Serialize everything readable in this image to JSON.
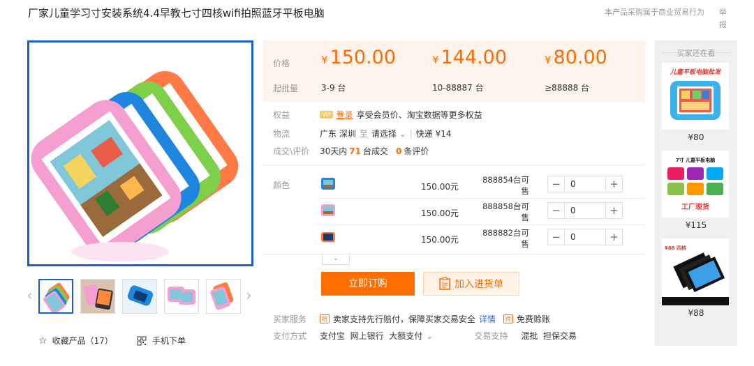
{
  "product": {
    "title": "厂家儿童学习寸安装系统4.4早教七寸四核wifi拍照蓝牙平板电脑",
    "report_note": "本产品采购属于商业贸易行为",
    "report_link": "举报"
  },
  "pricing": {
    "price_label": "价格",
    "moq_label": "起批量",
    "currency": "¥",
    "tiers": [
      {
        "price": "150.00",
        "qty": "3-9 台"
      },
      {
        "price": "144.00",
        "qty": "10-88887 台"
      },
      {
        "price": "80.00",
        "qty": "≥88888 台"
      }
    ]
  },
  "info": {
    "benefit_label": "权益",
    "vip": "VIP",
    "login": "登录",
    "benefit_text": "享受会员价、淘宝数据等更多权益",
    "logistics_label": "物流",
    "origin": "广东 深圳",
    "to": "至",
    "select": "请选择",
    "shipping": "快递 ¥14",
    "deal_label": "成交\\评价",
    "deals_prefix": "30天内",
    "deals_count": "71",
    "deals_suffix": "台成交",
    "reviews_count": "0",
    "reviews_suffix": "条评价"
  },
  "sku": {
    "color_label": "颜色",
    "rows": [
      {
        "price": "150.00元",
        "stock": "888854台可售",
        "qty": "0"
      },
      {
        "price": "150.00元",
        "stock": "888858台可售",
        "qty": "0"
      },
      {
        "price": "150.00元",
        "stock": "888882台可售",
        "qty": "0"
      }
    ],
    "minus": "−",
    "plus": "+"
  },
  "actions": {
    "buy": "立即订购",
    "cart": "加入进货单"
  },
  "service": {
    "buyer_label": "买家服务",
    "guarantee_tag": "赔",
    "guarantee_text": "卖家支持先行赔付，保障买家交易安全",
    "details": "详情",
    "free_tag": "赊",
    "free_text": "免费赊账",
    "payment_label": "支付方式",
    "payments": "支付宝  网上银行  大额支付",
    "trade_label": "交易支持",
    "trade_values": "混批  担保交易"
  },
  "left": {
    "collect": "收藏产品（17）",
    "mobile": "手机下单"
  },
  "side": {
    "title": "买家还在看",
    "items": [
      {
        "price": "¥80",
        "banner": "儿童平板电脑批发"
      },
      {
        "price": "¥115",
        "banner": "7寸 儿童平板电脑",
        "tag": "工厂现货"
      },
      {
        "price": "¥88",
        "label": "¥88 四核"
      }
    ]
  },
  "colors": {
    "accent": "#ff6e00",
    "selection": "#1a5fd0",
    "price_bg": "#fff4ec"
  }
}
